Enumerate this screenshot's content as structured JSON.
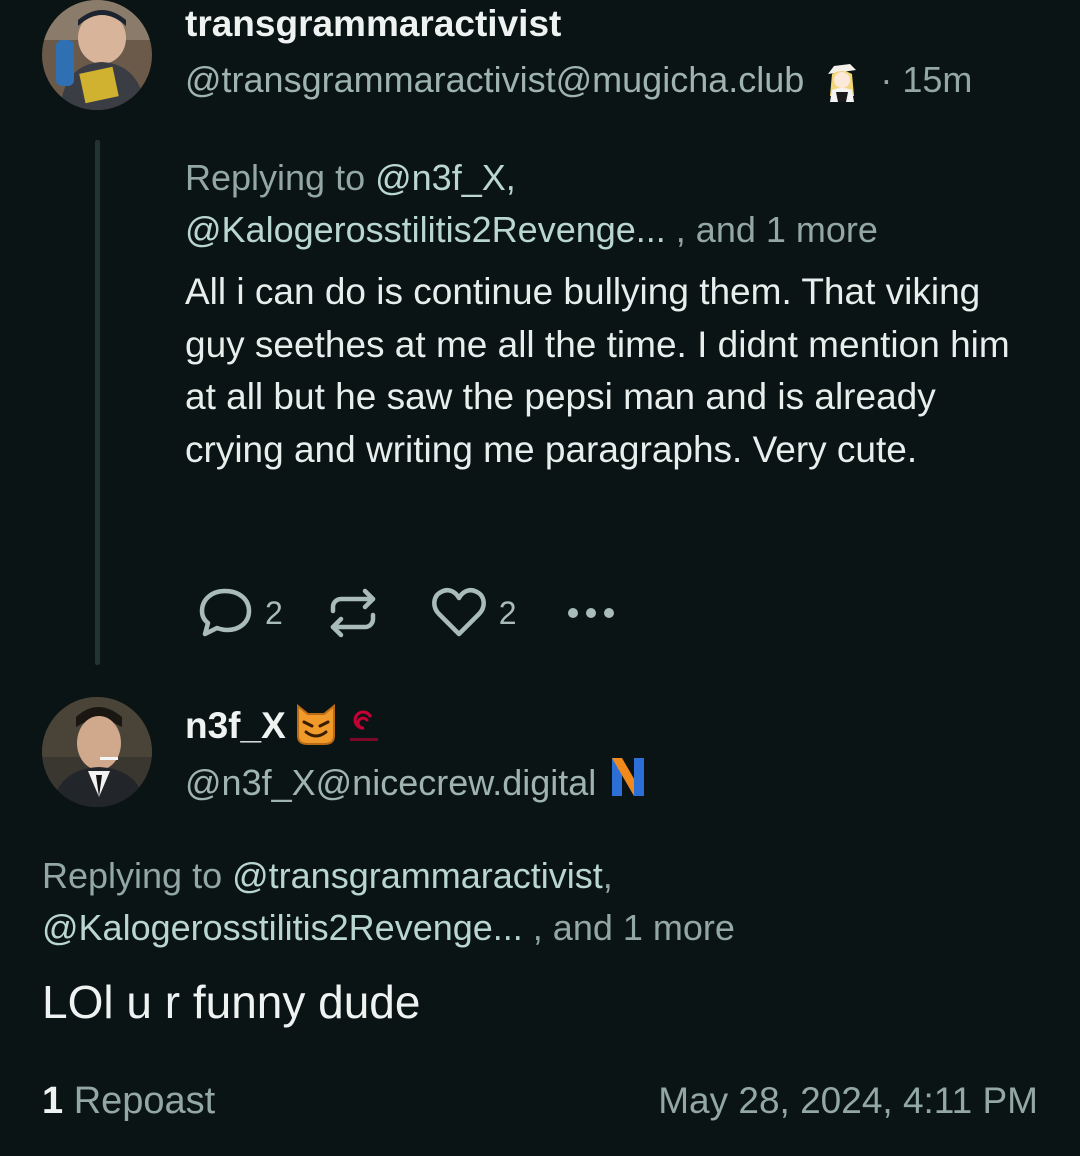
{
  "post1": {
    "display_name": "transgrammaractivist",
    "handle": "@transgrammaractivist@mugicha.club",
    "time_sep": "·",
    "time": "15m",
    "replying_prefix": "Replying to ",
    "reply_mention_1": "@n3f_X,",
    "reply_mention_2": "@Kalogerosstilitis2Revenge...",
    "reply_suffix": ", and 1 more",
    "content": "All i can do is continue bullying them. That viking guy seethes at me all the time. I didnt mention him at all but he saw the pepsi man and is already crying and writing me paragraphs. Very cute.",
    "actions": {
      "reply_icon": "reply-icon",
      "reply_count": "2",
      "repost_icon": "repost-icon",
      "like_icon": "heart-icon",
      "like_count": "2",
      "more_icon": "more-icon"
    }
  },
  "post2": {
    "display_name": "n3f_X",
    "handle": "@n3f_X@nicecrew.digital",
    "replying_prefix": "Replying to ",
    "reply_mention_1": "@transgrammaractivist",
    "reply_mention_comma": ",",
    "reply_mention_2": "@Kalogerosstilitis2Revenge...",
    "reply_suffix": ", and 1 more",
    "content": "LOl u r funny dude"
  },
  "footer": {
    "repost_count": "1",
    "repost_label": "Repoast",
    "timestamp": "May 28, 2024, 4:11 PM"
  },
  "colors": {
    "background": "#0b1414",
    "text": "#e7eeec",
    "muted": "#93a7a4",
    "emoji_orange": "#f19a2c",
    "debian_red": "#c70036",
    "instance_blue": "#2c6fd6"
  }
}
